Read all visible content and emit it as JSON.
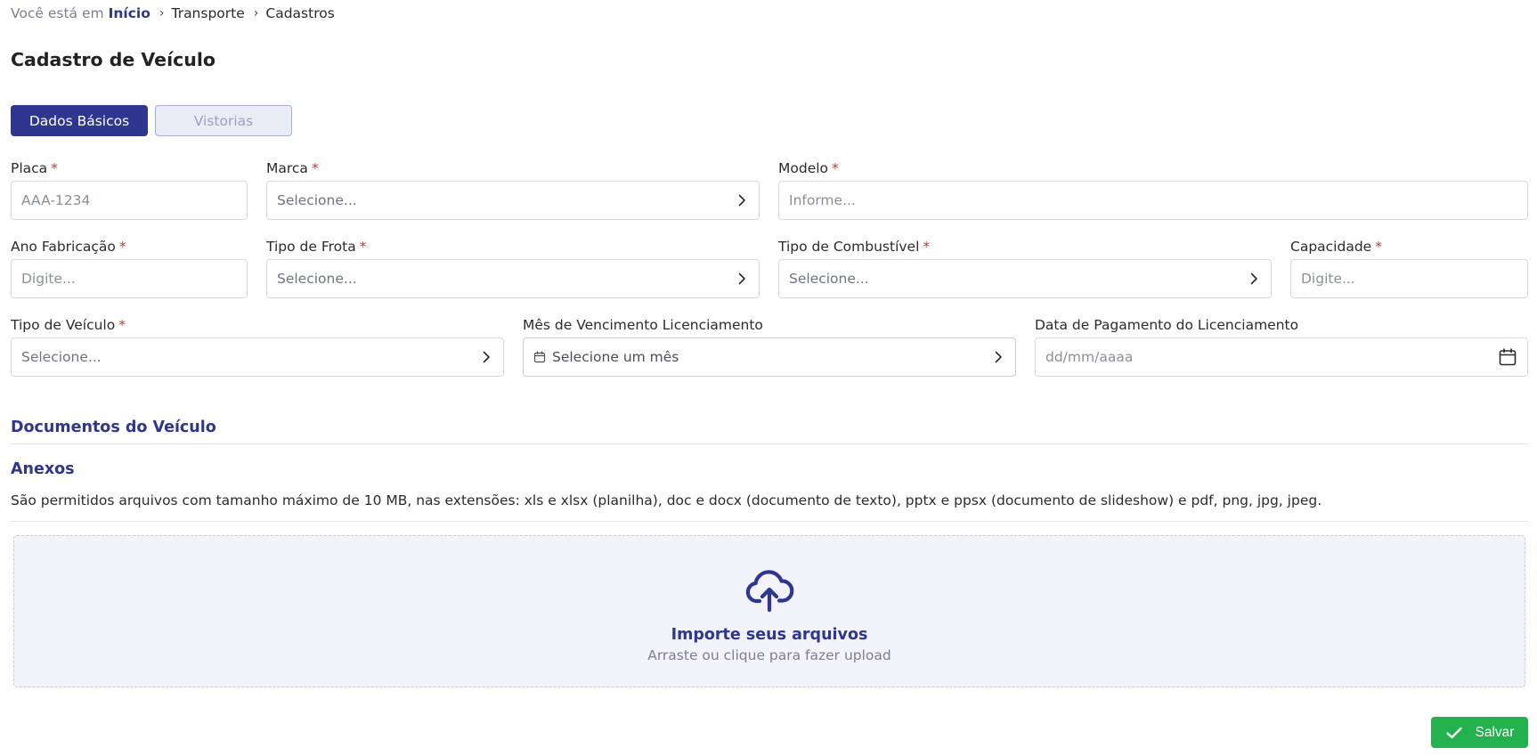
{
  "breadcrumb": {
    "prefix": "Você está em",
    "home": "Início",
    "items": [
      "Transporte",
      "Cadastros"
    ]
  },
  "page_title": "Cadastro de Veículo",
  "tabs": {
    "active": "Dados Básicos",
    "inactive": "Vistorias"
  },
  "required_mark": "*",
  "fields": {
    "placa": {
      "label": "Placa",
      "placeholder": "AAA-1234"
    },
    "marca": {
      "label": "Marca",
      "placeholder": "Selecione..."
    },
    "modelo": {
      "label": "Modelo",
      "placeholder": "Informe..."
    },
    "ano": {
      "label": "Ano Fabricação",
      "placeholder": "Digite..."
    },
    "tipo_frota": {
      "label": "Tipo de Frota",
      "placeholder": "Selecione..."
    },
    "combustivel": {
      "label": "Tipo de Combustível",
      "placeholder": "Selecione..."
    },
    "capacidade": {
      "label": "Capacidade",
      "placeholder": "Digite..."
    },
    "tipo_veiculo": {
      "label": "Tipo de Veículo",
      "placeholder": "Selecione..."
    },
    "mes_licenciamento": {
      "label": "Mês de Vencimento Licenciamento",
      "placeholder": "Selecione um mês"
    },
    "data_pagamento": {
      "label": "Data de Pagamento do Licenciamento",
      "placeholder": "dd/mm/aaaa"
    }
  },
  "documents": {
    "section_title": "Documentos do Veículo",
    "attachments_title": "Anexos",
    "info": "São permitidos arquivos com tamanho máximo de 10 MB, nas extensões: xls e xlsx (planilha), doc e docx (documento de texto), pptx e ppsx (documento de slideshow) e pdf, png, jpg, jpeg.",
    "dropzone_title": "Importe seus arquivos",
    "dropzone_subtitle": "Arraste ou clique para fazer upload"
  },
  "actions": {
    "save": "Salvar"
  },
  "colors": {
    "primary": "#2e3690",
    "required": "#e03131",
    "success": "#22b14c",
    "dropzone_bg": "#f2f3fb"
  },
  "icons": [
    "chevron-right-icon",
    "calendar-icon",
    "cloud-upload-icon",
    "check-icon"
  ]
}
